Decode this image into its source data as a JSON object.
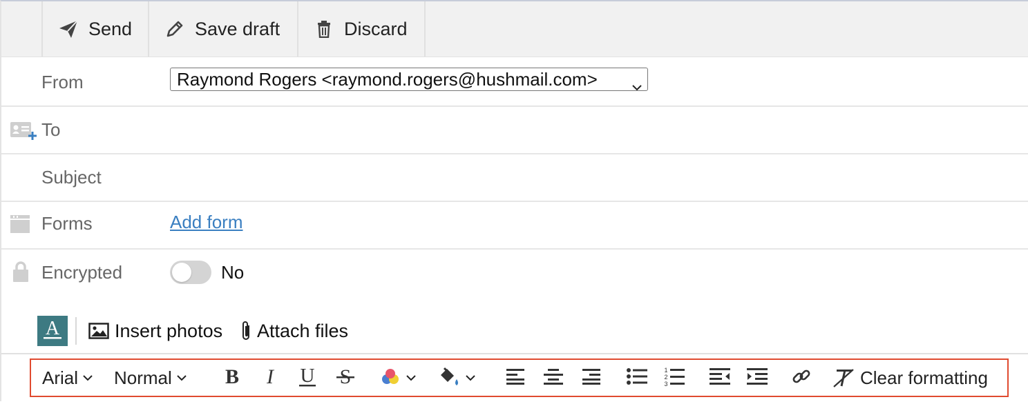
{
  "actions": {
    "send": "Send",
    "save_draft": "Save draft",
    "discard": "Discard"
  },
  "fields": {
    "from_label": "From",
    "from_value": "Raymond Rogers <raymond.rogers@hushmail.com>",
    "to_label": "To",
    "subject_label": "Subject",
    "forms_label": "Forms",
    "add_form": "Add form",
    "encrypted_label": "Encrypted",
    "encrypted_value": "No"
  },
  "insert": {
    "photos": "Insert photos",
    "files": "Attach files"
  },
  "format": {
    "font": "Arial",
    "size": "Normal",
    "clear": "Clear formatting",
    "icons": [
      "bold-icon",
      "italic-icon",
      "underline-icon",
      "strikethrough-icon",
      "text-color-icon",
      "highlight-color-icon",
      "align-left-icon",
      "align-center-icon",
      "align-right-icon",
      "bulleted-list-icon",
      "numbered-list-icon",
      "outdent-icon",
      "indent-icon",
      "link-icon",
      "clear-formatting-icon"
    ]
  },
  "colors": {
    "accent": "#3a7fc1",
    "format_button": "#3d7a82",
    "highlight_border": "#e04a2f",
    "toggle_off": "#d4d4d4"
  }
}
